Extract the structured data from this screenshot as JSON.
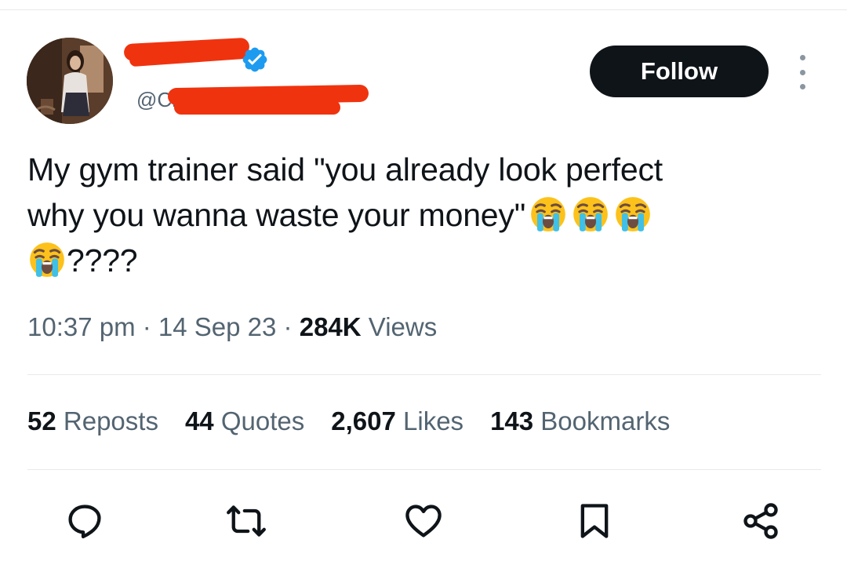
{
  "author": {
    "handle_prefix": "@Cl",
    "verified": true
  },
  "follow_button": {
    "label": "Follow"
  },
  "tweet": {
    "line1": "My gym trainer said \"you already look perfect",
    "line2": "why you wanna waste your money\"",
    "line3_suffix": "????",
    "emoji": "loudly-crying-face"
  },
  "meta": {
    "time": "10:37 pm",
    "sep1": " · ",
    "date": "14 Sep 23",
    "sep2": " · ",
    "views_count": "284K",
    "views_label": " Views"
  },
  "stats": [
    {
      "count": "52",
      "label": " Reposts"
    },
    {
      "count": "44",
      "label": " Quotes"
    },
    {
      "count": "2,607",
      "label": " Likes"
    },
    {
      "count": "143",
      "label": " Bookmarks"
    }
  ],
  "actions": [
    "reply-icon",
    "repost-icon",
    "like-icon",
    "bookmark-icon",
    "share-icon"
  ],
  "colors": {
    "primary_text": "#0f1419",
    "secondary_text": "#536471",
    "verified_blue": "#1d9bf0",
    "redaction": "#f0330f",
    "divider": "#e6e9ec"
  }
}
